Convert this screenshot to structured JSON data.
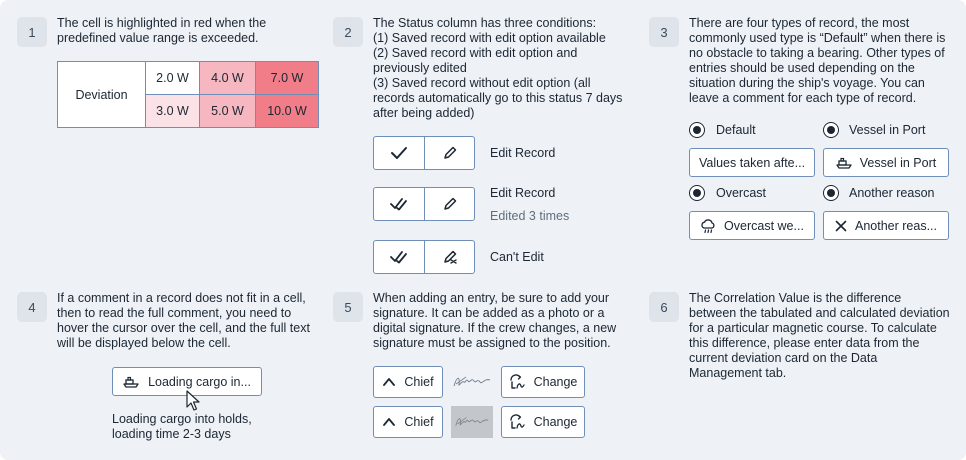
{
  "panel1": {
    "number": "1",
    "text": "The cell is highlighted in red when the predefined value range is exceeded.",
    "table": {
      "row_label": "Deviation",
      "rows": [
        [
          "2.0 W",
          "4.0 W",
          "7.0 W"
        ],
        [
          "3.0 W",
          "5.0 W",
          "10.0 W"
        ]
      ]
    },
    "colors": {
      "light": "#fbe2e6",
      "medium": "#f6b7c0",
      "strong": "#f07d87"
    }
  },
  "panel2": {
    "number": "2",
    "intro": "The Status column has three conditions:",
    "line1": "(1) Saved record with edit option available",
    "line2": "(2) Saved record with edit option and previously edited",
    "line3": "(3) Saved record without edit option (all records automatically go to this status 7 days after being added)",
    "status1": {
      "label": "Edit Record"
    },
    "status2": {
      "label": "Edit Record",
      "sub": "Edited 3 times"
    },
    "status3": {
      "label": "Can't Edit"
    }
  },
  "panel3": {
    "number": "3",
    "text": "There are four types of record, the most commonly used type is “Default” when there is no obstacle to taking a bearing. Other types of entries should be used depending on the situation during the ship's voyage. You can leave a comment for each type of record.",
    "options": [
      {
        "label": "Default",
        "button": "Values taken afte...",
        "icon": "none"
      },
      {
        "label": "Vessel in Port",
        "button": "Vessel in Port",
        "icon": "ship-icon"
      },
      {
        "label": "Overcast",
        "button": "Overcast we...",
        "icon": "cloud-rain-icon"
      },
      {
        "label": "Another reason",
        "button": "Another reas...",
        "icon": "close-icon"
      }
    ]
  },
  "panel4": {
    "number": "4",
    "text": "If a comment in a record does not fit in a cell, then to read the full comment, you need to hover the cursor over the cell, and the full text will be displayed below the cell.",
    "button": "Loading cargo in...",
    "tooltip": "Loading cargo into holds, loading time 2-3 days"
  },
  "panel5": {
    "number": "5",
    "text": "When adding an entry, be sure to add your signature. It can be added as a photo or a digital signature. If the crew changes, a new signature must be assigned to the position.",
    "rows": [
      {
        "position": "Chief",
        "change": "Change"
      },
      {
        "position": "Chief",
        "change": "Change"
      }
    ]
  },
  "panel6": {
    "number": "6",
    "text": "The Correlation Value is the difference between the tabulated and calculated deviation for a particular magnetic course. To calculate this difference, please enter data from the current deviation card on the Data Management tab."
  }
}
